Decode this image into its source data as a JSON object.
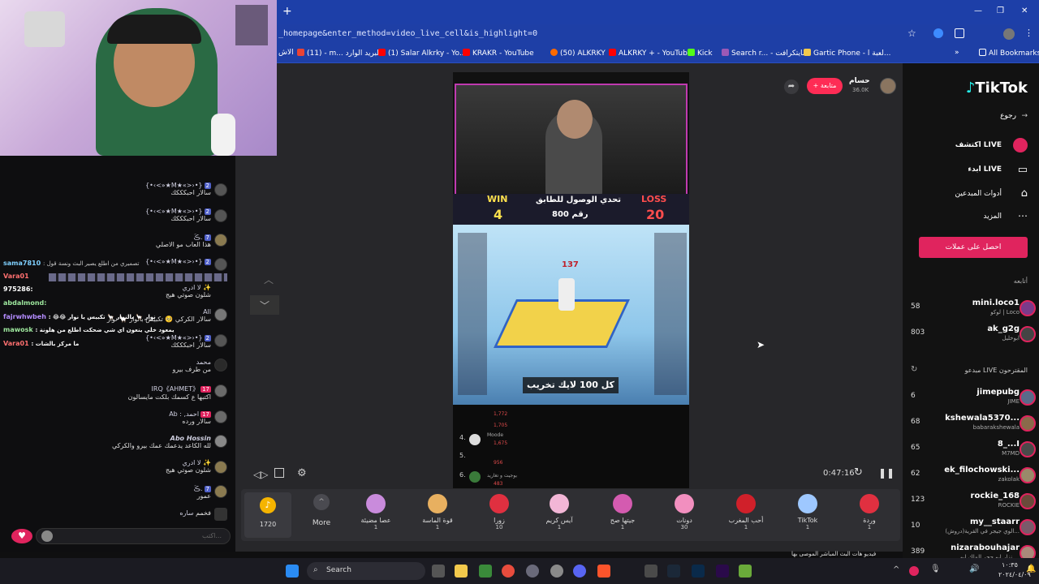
{
  "browser": {
    "url": "_homepage&enter_method=video_live_cell&is_highlight=0",
    "bookmarks": [
      "الاش",
      "(11) - m... البريد الوارد",
      "(1) Salar Alkrky - Yo...",
      "KRAKR - YouTube",
      "(50) ALKRKY",
      "ALKRKY + - YouTube",
      "Kick",
      "Search r... - مايتكرافت",
      "Gartic Phone - لعبة ا..."
    ],
    "all_bookmarks": "All Bookmarks"
  },
  "chat": {
    "messages": [
      {
        "name": "{•‹<»★M★«>›•}",
        "text": "سالار احبكككك",
        "badge": "2"
      },
      {
        "name": "{•‹<»★M★«>›•}",
        "text": "سالار احبكككك",
        "badge": "2"
      },
      {
        "name": "ڪَ.",
        "text": "هذا العاب مو الاصلي",
        "badge": "7"
      },
      {
        "name": "{•‹<»★M★«>›•}",
        "text": "تصميري من اطلع يصير البث ونسة قول",
        "badge": "2"
      },
      {
        "name": "لا ادري ✨",
        "text": "شلون صوتي هيج",
        "badge": ""
      },
      {
        "name": "All",
        "text": "سالار الكركي 🥺 تكبيس بالوار 🦙 نوار",
        "badge": ""
      },
      {
        "name": "{•‹<»★M★«>›•}",
        "text": "سالار احبكككك",
        "badge": "2"
      },
      {
        "name": "محمد",
        "text": "من طرف بيرو",
        "badge": ""
      },
      {
        "name": "IRQ《AHMET》",
        "text": "اكتبها ع كسمك بلكت مايسالون",
        "badge": "17"
      },
      {
        "name": "Ab : ,احمد",
        "text": "سالار ورده",
        "badge": "17"
      },
      {
        "name": "Abo Hossin",
        "text": "لله الكاعد يدعمك عمك بيرو والكركي",
        "badge": ""
      },
      {
        "name": "لا ادري ✨",
        "text": "شلون صوتي هيج",
        "badge": ""
      },
      {
        "name": "ڪَ.",
        "text": "عمور",
        "badge": "7"
      },
      {
        "name": "ساره",
        "text": "فخمم",
        "badge": ""
      }
    ],
    "overlay_names": [
      {
        "name": "sama7810",
        "text": ": تصميري من اطلع يصير البث ونسة قول"
      },
      {
        "name": "Vara01",
        "text": ""
      },
      {
        "name": "975286",
        "text": ":"
      },
      {
        "name": "abdalmond",
        "text": ":"
      },
      {
        "name": "fajrwhwbeh",
        "text": ": 😂😂 نوار 🦙 بالنوار 🦙 تكبيس يا نوار"
      },
      {
        "name": "mawosk",
        "text": ": يمعود خلي ينعون اي شي ضحكت اطلع من هلونة"
      },
      {
        "name": "Vara01",
        "text": ": ما مركز بالشات"
      }
    ],
    "input_placeholder": "اكتب..."
  },
  "stream": {
    "host_name": "حسام",
    "host_followers": "36.0K",
    "follow_label": "+ متابعة",
    "win_label": "WIN",
    "win_value": "4",
    "loss_label": "LOSS",
    "loss_value": "20",
    "challenge_title": "تحدي الوصول للطابق",
    "challenge_floor": "800 رقم",
    "game_score": "137",
    "like_text": "كل 100 لايك تخريب",
    "time": "0:47:16",
    "ranks": [
      {
        "rank": "4.",
        "name": "Moode",
        "score": "1,675"
      },
      {
        "rank": "5.",
        "name": "",
        "score": "956"
      },
      {
        "rank": "6.",
        "name": "بوجيت و تغاريد",
        "score": "483"
      }
    ],
    "ranks_top": [
      "1,772",
      "1,705"
    ]
  },
  "gifts": {
    "coins": "1720",
    "more": "More",
    "items": [
      {
        "name": "عصا مضيئة",
        "cost": "1",
        "color": "#c98bdc"
      },
      {
        "name": "قوة الماسة",
        "cost": "1",
        "color": "#e8b060"
      },
      {
        "name": "زورا",
        "cost": "10",
        "color": "#e03040"
      },
      {
        "name": "آيس كريم",
        "cost": "1",
        "color": "#f2b6d6"
      },
      {
        "name": "جيتها صح",
        "cost": "1",
        "color": "#d45bb0"
      },
      {
        "name": "دونات",
        "cost": "30",
        "color": "#f28fbf"
      },
      {
        "name": "أحب المغرب",
        "cost": "1",
        "color": "#d0202a"
      },
      {
        "name": "TikTok",
        "cost": "1",
        "color": "#9ec8ff"
      },
      {
        "name": "وردة",
        "cost": "1",
        "color": "#e03040"
      }
    ]
  },
  "sidebar": {
    "logo": "TikTok",
    "back": "رجوع",
    "nav": [
      "اكتشف LIVE",
      "ابدء LIVE",
      "أدوات المبدعين",
      "المزيد"
    ],
    "cta": "احصل على عملات",
    "following_label": "أتابعه",
    "following": [
      {
        "name": "mini.loco1",
        "sub": "لوكو | Loco",
        "count": "58"
      },
      {
        "name": "ak_g2g",
        "sub": "ابوخليل",
        "count": "803"
      }
    ],
    "suggested_label": "مبدعو LIVE المقترحون",
    "suggested": [
      {
        "name": "jimepubg",
        "sub": "JIME",
        "count": "6"
      },
      {
        "name": "kshewala5370...",
        "sub": "babarakshewala",
        "count": "68"
      },
      {
        "name": "8_...I",
        "sub": "M7MD",
        "count": "65"
      },
      {
        "name": "ek_filochowski...",
        "sub": "zakolak",
        "count": "62"
      },
      {
        "name": "rockie_168",
        "sub": "ROCKIE",
        "count": "123"
      },
      {
        "name": "my__staarr",
        "sub": "الوي جيجر في القرية(دروش)...",
        "count": "10"
      },
      {
        "name": "nizarabouhajar",
        "sub": "نزار ابو حجر الملك ابو ...",
        "count": "389"
      }
    ],
    "footer_text": "فيديو هات البث المباشر الموصى بها"
  },
  "taskbar": {
    "search": "Search",
    "time": "١٠:٣٥",
    "date": "٢٠٢٤/٠٤/٠٩"
  }
}
